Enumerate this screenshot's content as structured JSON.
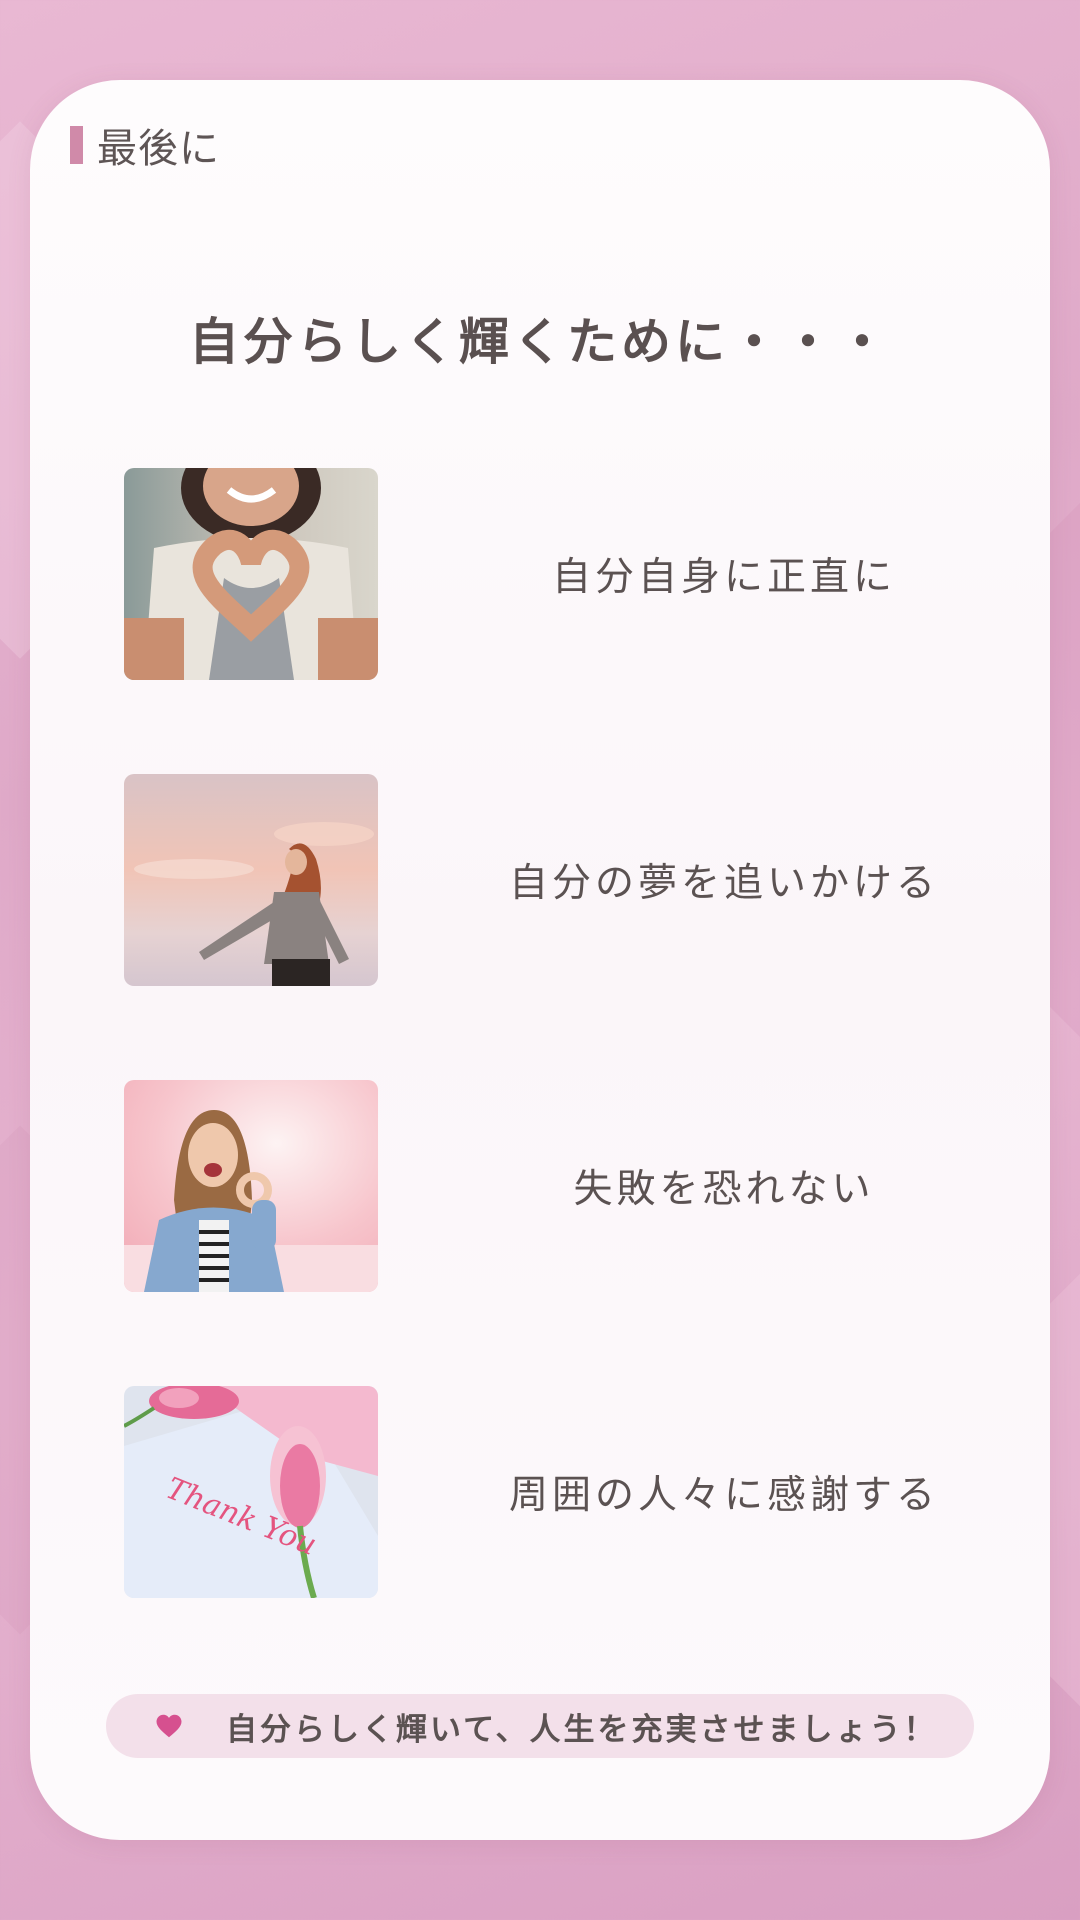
{
  "section": {
    "label": "最後に"
  },
  "headline": "自分らしく輝くために・・・",
  "items": [
    {
      "caption": "自分自身に正直に",
      "image": "heart-hands-photo"
    },
    {
      "caption": "自分の夢を追いかける",
      "image": "woman-sky-photo"
    },
    {
      "caption": "失敗を恐れない",
      "image": "woman-ok-gesture-photo"
    },
    {
      "caption": "周囲の人々に感謝する",
      "image": "thank-you-tulip-photo",
      "photo_text": "Thank You"
    }
  ],
  "footer": {
    "icon": "heart-icon",
    "message": "自分らしく輝いて、人生を充実させましょう！"
  },
  "colors": {
    "background": "#e3b0cd",
    "card": "#fdf9fb",
    "accent_bar": "#d08aa9",
    "text": "#5b5252",
    "footer_pill": "#f3e0ea",
    "heart": "#d6508f"
  }
}
